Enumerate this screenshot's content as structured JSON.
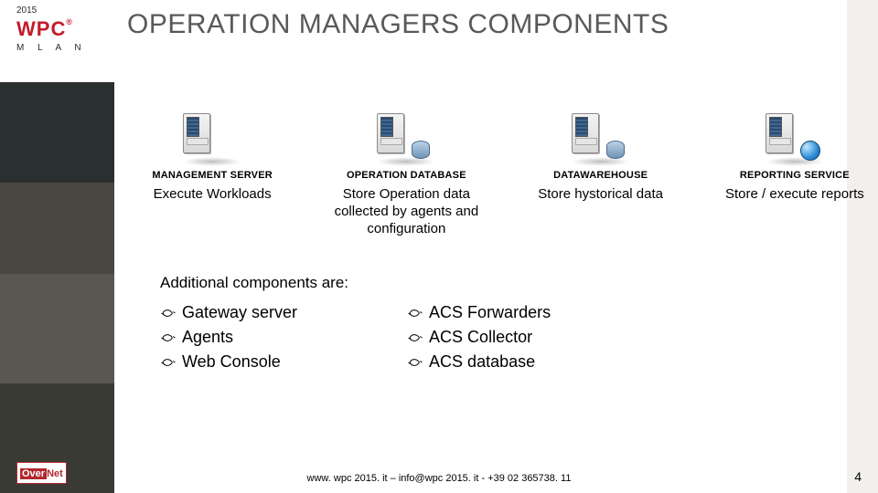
{
  "header": {
    "year": "2015",
    "logo": "WPC",
    "logo_sub": "M  L A N  "
  },
  "title": "OPERATION MANAGERS COMPONENTS",
  "servers": [
    {
      "label": "MANAGEMENT SERVER",
      "desc": "Execute Workloads",
      "variant": "plain"
    },
    {
      "label": "OPERATION DATABASE",
      "desc": "Store Operation data collected by agents and configuration",
      "variant": "db"
    },
    {
      "label": "DATAWAREHOUSE",
      "desc": "Store hystorical data",
      "variant": "db"
    },
    {
      "label": "REPORTING SERVICE",
      "desc": "Store / execute reports",
      "variant": "globe"
    }
  ],
  "additional": {
    "heading": "Additional components are:",
    "col1": [
      "Gateway server",
      "Agents",
      "Web Console"
    ],
    "col2": [
      "ACS Forwarders",
      "ACS Collector",
      "ACS database"
    ]
  },
  "footer": "www. wpc 2015. it – info@wpc 2015. it - +39 02 365738. 11",
  "page_number": "4",
  "overnet": {
    "a": "Over",
    "b": "Net"
  }
}
